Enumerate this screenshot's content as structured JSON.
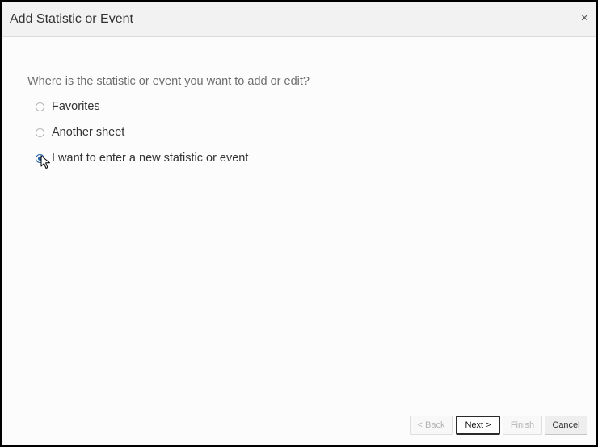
{
  "dialog": {
    "title": "Add Statistic or Event",
    "close_label": "×"
  },
  "question": "Where is the statistic or event you want to add or edit?",
  "options": [
    {
      "label": "Favorites",
      "selected": false
    },
    {
      "label": "Another sheet",
      "selected": false
    },
    {
      "label": "I want to enter a new statistic or event",
      "selected": true
    }
  ],
  "buttons": {
    "back": "< Back",
    "next": "Next >",
    "finish": "Finish",
    "cancel": "Cancel"
  },
  "colors": {
    "accent": "#1f5fa8",
    "title_bar": "#f2f2f2"
  }
}
